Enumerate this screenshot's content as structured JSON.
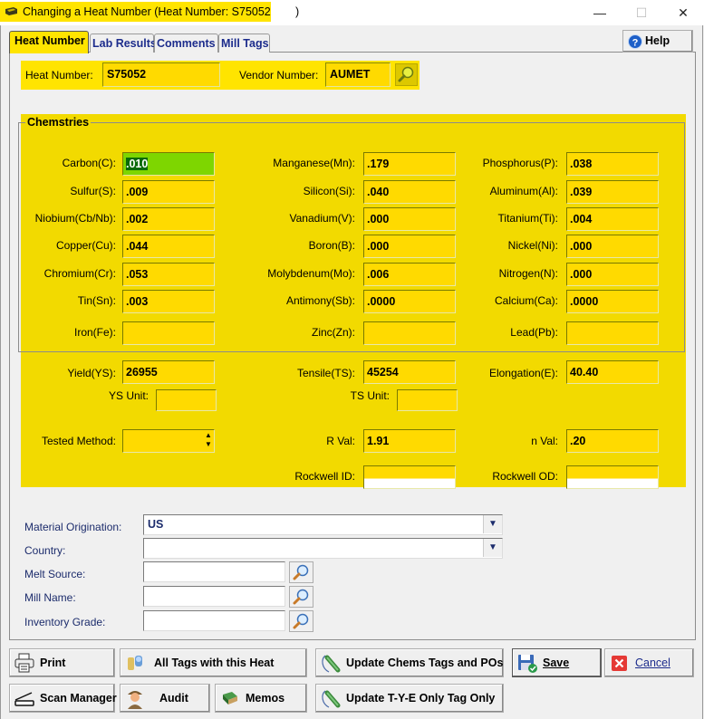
{
  "window": {
    "title": "Changing a Heat Number  (Heat Number: S75052",
    "title_tail": ")",
    "minimize": "—",
    "maximize": "☐",
    "close": "✕"
  },
  "tabs": [
    {
      "label": "Heat Number",
      "active": true
    },
    {
      "label": "Lab Results",
      "active": false
    },
    {
      "label": "Comments",
      "active": false
    },
    {
      "label": "Mill Tags",
      "active": false
    }
  ],
  "help": {
    "label": "Help",
    "icon": "help-icon"
  },
  "header": {
    "heat_number_label": "Heat Number:",
    "heat_number_value": "S75052",
    "vendor_number_label": "Vendor Number:",
    "vendor_number_value": "AUMET",
    "vendor_search_icon": "search-icon"
  },
  "chemistries": {
    "title": "Chemstries",
    "col1": [
      {
        "label": "Carbon(C):",
        "value": ".010",
        "selected": true
      },
      {
        "label": "Sulfur(S):",
        "value": ".009"
      },
      {
        "label": "Niobium(Cb/Nb):",
        "value": ".002"
      },
      {
        "label": "Copper(Cu):",
        "value": ".044"
      },
      {
        "label": "Chromium(Cr):",
        "value": ".053"
      },
      {
        "label": "Tin(Sn):",
        "value": ".003"
      },
      {
        "label": "Iron(Fe):",
        "value": ""
      }
    ],
    "col2": [
      {
        "label": "Manganese(Mn):",
        "value": ".179"
      },
      {
        "label": "Silicon(Si):",
        "value": ".040"
      },
      {
        "label": "Vanadium(V):",
        "value": ".000"
      },
      {
        "label": "Boron(B):",
        "value": ".000"
      },
      {
        "label": "Molybdenum(Mo):",
        "value": ".006"
      },
      {
        "label": "Antimony(Sb):",
        "value": ".0000"
      },
      {
        "label": "Zinc(Zn):",
        "value": ""
      }
    ],
    "col3": [
      {
        "label": "Phosphorus(P):",
        "value": ".038"
      },
      {
        "label": "Aluminum(Al):",
        "value": ".039"
      },
      {
        "label": "Titanium(Ti):",
        "value": ".004"
      },
      {
        "label": "Nickel(Ni):",
        "value": ".000"
      },
      {
        "label": "Nitrogen(N):",
        "value": ".000"
      },
      {
        "label": "Calcium(Ca):",
        "value": ".0000"
      },
      {
        "label": "Lead(Pb):",
        "value": ""
      }
    ]
  },
  "mechanical": {
    "yield_label": "Yield(YS):",
    "yield_value": "26955",
    "tensile_label": "Tensile(TS):",
    "tensile_value": "45254",
    "elongation_label": "Elongation(E):",
    "elongation_value": "40.40",
    "ys_unit_label": "YS Unit:",
    "ys_unit_value": "",
    "ts_unit_label": "TS Unit:",
    "ts_unit_value": "",
    "tested_method_label": "Tested Method:",
    "tested_method_value": "",
    "r_val_label": "R Val:",
    "r_val_value": "1.91",
    "n_val_label": "n Val:",
    "n_val_value": ".20",
    "rockwell_id_label": "Rockwell ID:",
    "rockwell_id_value": "",
    "rockwell_od_label": "Rockwell OD:",
    "rockwell_od_value": ""
  },
  "origin": {
    "material_origination_label": "Material Origination:",
    "material_origination_value": "US",
    "country_label": "Country:",
    "country_value": "",
    "melt_source_label": "Melt Source:",
    "melt_source_value": "",
    "mill_name_label": "Mill Name:",
    "mill_name_value": "",
    "inventory_grade_label": "Inventory Grade:",
    "inventory_grade_value": ""
  },
  "buttons": {
    "print": "Print",
    "all_tags": "All Tags with this Heat",
    "update_chems": "Update Chems Tags and POs",
    "save": "Save",
    "cancel": "Cancel",
    "scan_manager": "Scan Manager",
    "audit": "Audit",
    "memos": "Memos",
    "update_tye": "Update T-Y-E Only Tag Only"
  },
  "colors": {
    "highlight_yellow": "#ffe400",
    "field_yellow": "#ffda00",
    "selected_green": "#7ed600",
    "label_blue": "#1c2c6c"
  }
}
